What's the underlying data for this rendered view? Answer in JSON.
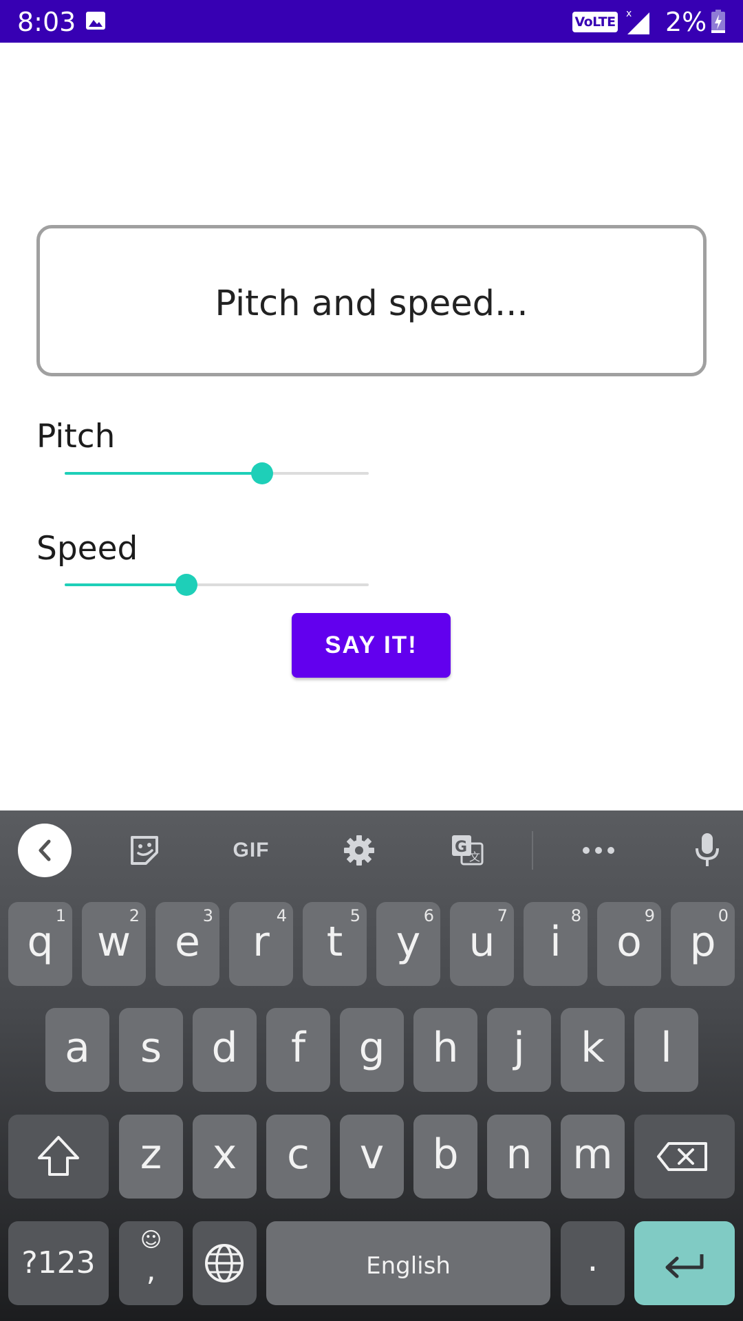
{
  "status_bar": {
    "time": "8:03",
    "network_badge": "VoLTE",
    "battery_percent": "2%",
    "icons": [
      "image-icon",
      "signal-icon",
      "battery-charging-icon"
    ]
  },
  "input": {
    "value": "Pitch and speed..."
  },
  "pitch": {
    "label": "Pitch",
    "value_fraction": 0.65
  },
  "speed": {
    "label": "Speed",
    "value_fraction": 0.4
  },
  "say_button": {
    "label": "SAY IT!"
  },
  "colors": {
    "status_bar": "#3700b3",
    "button": "#6200ee",
    "slider_accent": "#1ecfb8",
    "enter_key": "#80cbc4"
  },
  "keyboard": {
    "toolbar": {
      "gif_label": "GIF",
      "icons": [
        "back-icon",
        "sticker-icon",
        "gif-icon",
        "settings-icon",
        "translate-icon",
        "more-icon",
        "microphone-icon"
      ]
    },
    "row1": [
      {
        "ch": "q",
        "num": "1"
      },
      {
        "ch": "w",
        "num": "2"
      },
      {
        "ch": "e",
        "num": "3"
      },
      {
        "ch": "r",
        "num": "4"
      },
      {
        "ch": "t",
        "num": "5"
      },
      {
        "ch": "y",
        "num": "6"
      },
      {
        "ch": "u",
        "num": "7"
      },
      {
        "ch": "i",
        "num": "8"
      },
      {
        "ch": "o",
        "num": "9"
      },
      {
        "ch": "p",
        "num": "0"
      }
    ],
    "row2": [
      "a",
      "s",
      "d",
      "f",
      "g",
      "h",
      "j",
      "k",
      "l"
    ],
    "row3": [
      "z",
      "x",
      "c",
      "v",
      "b",
      "n",
      "m"
    ],
    "symbols_label": "?123",
    "comma_label": ",",
    "emoji_glyph": "☺",
    "space_label": "English",
    "period_label": "."
  }
}
